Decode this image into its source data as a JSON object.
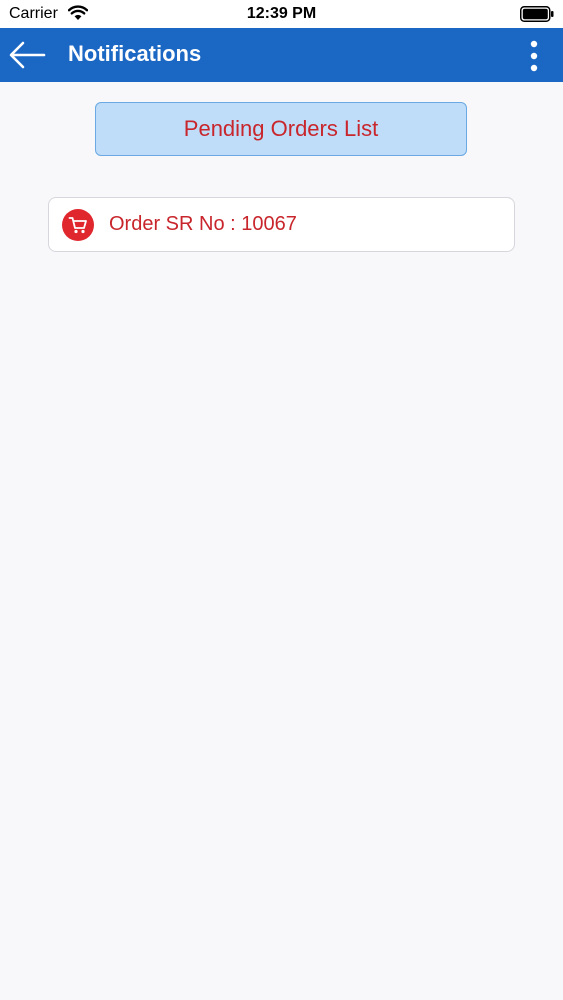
{
  "status_bar": {
    "carrier": "Carrier",
    "time": "12:39 PM"
  },
  "app_bar": {
    "title": "Notifications"
  },
  "pending_button": {
    "label": "Pending Orders List"
  },
  "orders": [
    {
      "label": "Order SR No : 10067",
      "icon": "cart-icon"
    }
  ],
  "colors": {
    "app_bar": "#1b67c4",
    "accent_red": "#c8262c",
    "button_bg": "#bfdcf8",
    "background": "#f8f8fb"
  }
}
